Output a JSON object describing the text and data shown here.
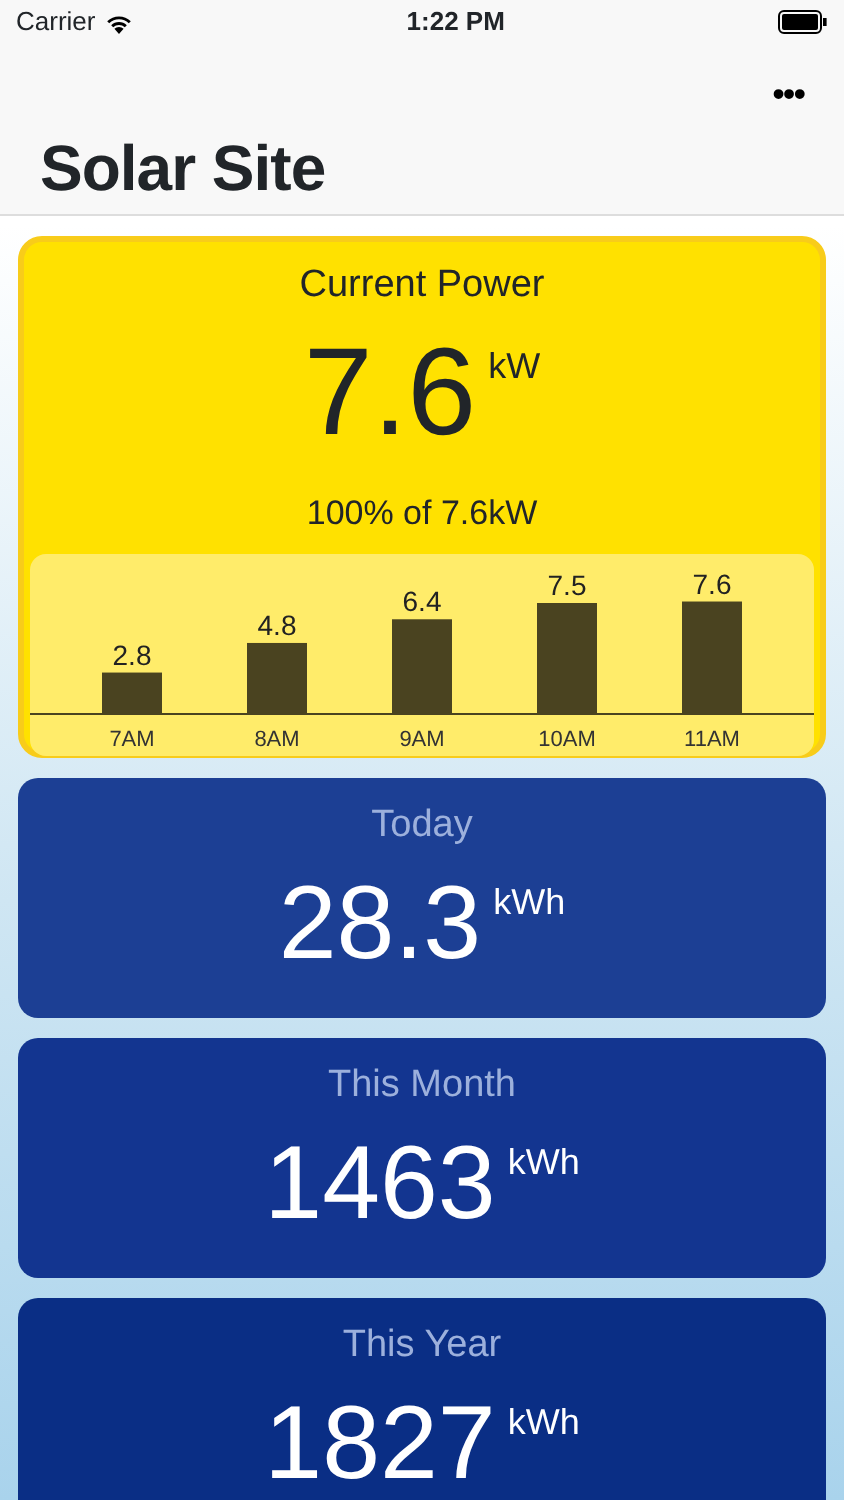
{
  "status_bar": {
    "carrier": "Carrier",
    "time": "1:22 PM"
  },
  "nav": {
    "title": "Solar Site",
    "more": "•••"
  },
  "current": {
    "title": "Current Power",
    "value": "7.6",
    "unit": "kW",
    "subtitle": "100% of 7.6kW",
    "chart_data": {
      "type": "bar",
      "categories": [
        "7AM",
        "8AM",
        "9AM",
        "10AM",
        "11AM"
      ],
      "series": [
        {
          "color": "#4a4320",
          "values": [
            2.8,
            4.8,
            6.4,
            7.5,
            7.6
          ]
        }
      ],
      "data_labels": true
    }
  },
  "totals": [
    {
      "label": "Today",
      "value": "28.3",
      "unit": "kWh",
      "color": "#1c3f94"
    },
    {
      "label": "This Month",
      "value": "1463",
      "unit": "kWh",
      "color": "#133590"
    },
    {
      "label": "This Year",
      "value": "1827",
      "unit": "kWh",
      "color": "#0a2e85"
    }
  ]
}
